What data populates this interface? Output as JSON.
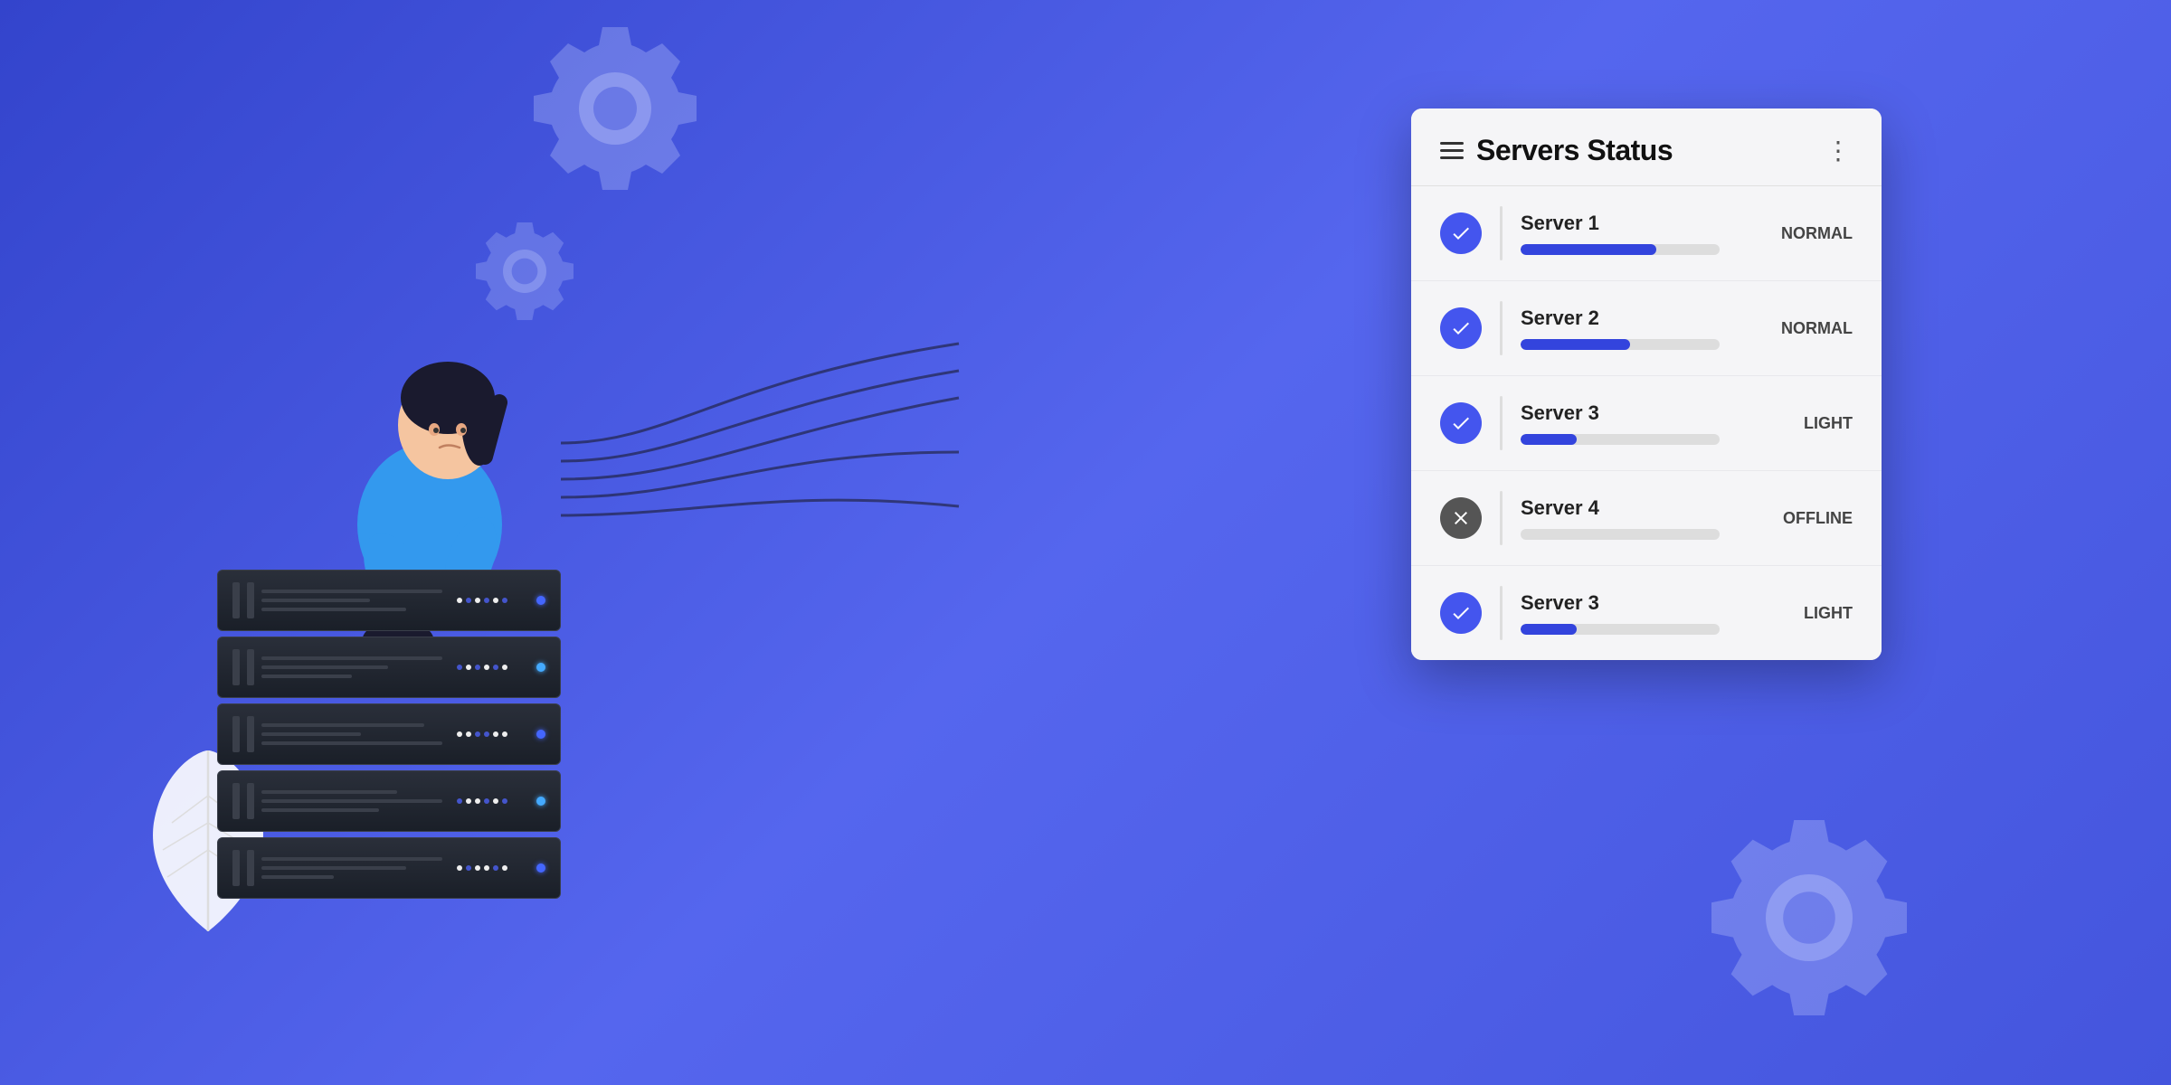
{
  "page": {
    "title": "Servers Status",
    "background_color": "#4455dd"
  },
  "panel": {
    "title": "Servers Status",
    "menu_icon": "menu-icon",
    "more_icon": "⋮",
    "servers": [
      {
        "id": "server-1",
        "name": "Server 1",
        "status": "NORMAL",
        "status_type": "online",
        "progress": 68
      },
      {
        "id": "server-2",
        "name": "Server 2",
        "status": "NORMAL",
        "status_type": "online",
        "progress": 55
      },
      {
        "id": "server-3",
        "name": "Server 3",
        "status": "LIGHT",
        "status_type": "online",
        "progress": 28
      },
      {
        "id": "server-4",
        "name": "Server 4",
        "status": "OFFLINE",
        "status_type": "offline",
        "progress": 0
      },
      {
        "id": "server-5",
        "name": "Server 3",
        "status": "LIGHT",
        "status_type": "online",
        "progress": 28
      }
    ]
  }
}
